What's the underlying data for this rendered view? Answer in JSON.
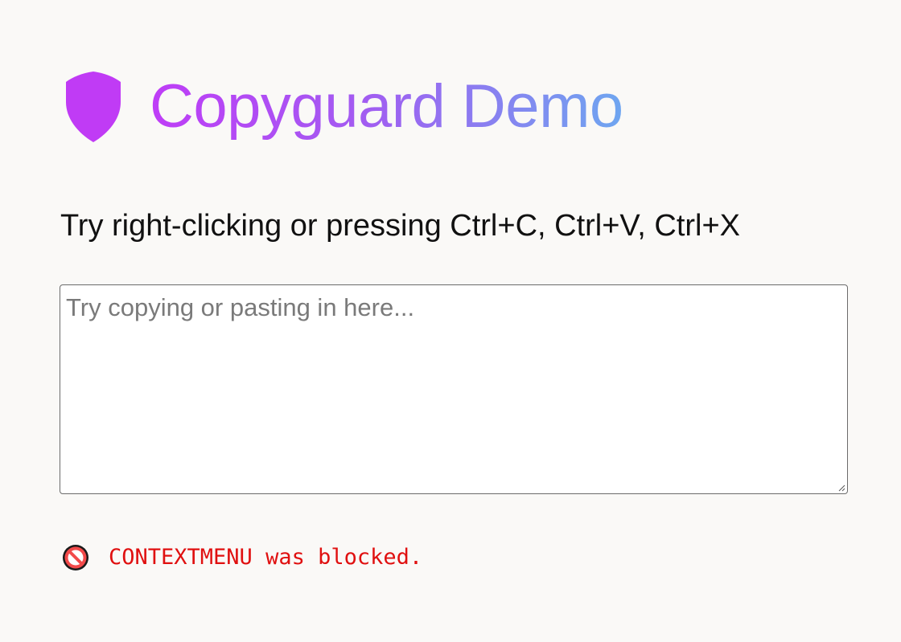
{
  "header": {
    "title": "Copyguard Demo",
    "logo_icon": "shield-icon",
    "title_gradient": [
      "#bf3df7",
      "#a25cf1",
      "#6ea6f0"
    ],
    "shield_color": "#c03bf5"
  },
  "intro": {
    "text": "Try right-clicking or pressing Ctrl+C, Ctrl+V, Ctrl+X"
  },
  "editor": {
    "value": "",
    "placeholder": "Try copying or pasting in here..."
  },
  "status": {
    "icon": "prohibited-icon",
    "message": "CONTEXTMENU was blocked.",
    "color": "#e01010"
  },
  "colors": {
    "background": "#faf9f7",
    "text": "#111111"
  }
}
